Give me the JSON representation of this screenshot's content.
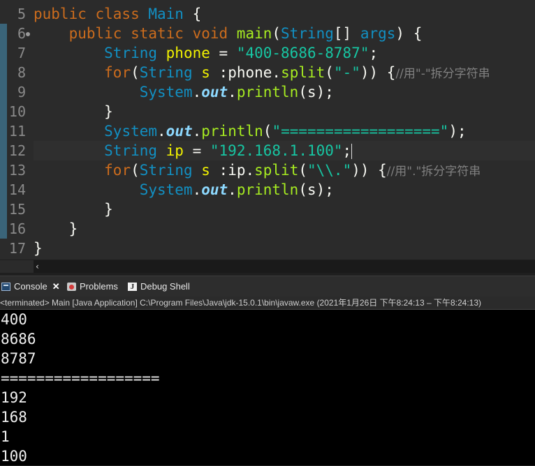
{
  "editor": {
    "line_numbers": [
      "5",
      "6",
      "7",
      "8",
      "9",
      "10",
      "11",
      "12",
      "13",
      "14",
      "15",
      "16",
      "17"
    ],
    "lines": [
      [
        {
          "t": "public class ",
          "c": "kw"
        },
        {
          "t": "Main",
          "c": "ty"
        },
        {
          "t": " {",
          "c": "pl"
        }
      ],
      [
        {
          "t": "    public static void ",
          "c": "kw"
        },
        {
          "t": "main",
          "c": "mt"
        },
        {
          "t": "(",
          "c": "pl"
        },
        {
          "t": "String",
          "c": "ty"
        },
        {
          "t": "[] ",
          "c": "pl"
        },
        {
          "t": "args",
          "c": "ty"
        },
        {
          "t": ") {",
          "c": "pl"
        }
      ],
      [
        {
          "t": "        ",
          "c": "pl"
        },
        {
          "t": "String",
          "c": "ty"
        },
        {
          "t": " phone",
          "c": "var"
        },
        {
          "t": " = ",
          "c": "pl"
        },
        {
          "t": "\"400-8686-8787\"",
          "c": "str"
        },
        {
          "t": ";",
          "c": "pl"
        }
      ],
      [
        {
          "t": "        ",
          "c": "pl"
        },
        {
          "t": "for",
          "c": "kw"
        },
        {
          "t": "(",
          "c": "pl"
        },
        {
          "t": "String",
          "c": "ty"
        },
        {
          "t": " s ",
          "c": "var"
        },
        {
          "t": ":phone.",
          "c": "pl"
        },
        {
          "t": "split",
          "c": "mt"
        },
        {
          "t": "(",
          "c": "pl"
        },
        {
          "t": "\"-\"",
          "c": "str"
        },
        {
          "t": ")) {",
          "c": "pl"
        },
        {
          "t": "//用\"-\"拆分字符串",
          "c": "cm"
        }
      ],
      [
        {
          "t": "            ",
          "c": "pl"
        },
        {
          "t": "System",
          "c": "ty"
        },
        {
          "t": ".",
          "c": "pl"
        },
        {
          "t": "out",
          "c": "fld"
        },
        {
          "t": ".",
          "c": "pl"
        },
        {
          "t": "println",
          "c": "mt"
        },
        {
          "t": "(s);",
          "c": "pl"
        }
      ],
      [
        {
          "t": "        }",
          "c": "pl"
        }
      ],
      [
        {
          "t": "        ",
          "c": "pl"
        },
        {
          "t": "System",
          "c": "ty"
        },
        {
          "t": ".",
          "c": "pl"
        },
        {
          "t": "out",
          "c": "fld"
        },
        {
          "t": ".",
          "c": "pl"
        },
        {
          "t": "println",
          "c": "mt"
        },
        {
          "t": "(",
          "c": "pl"
        },
        {
          "t": "\"==================\"",
          "c": "str"
        },
        {
          "t": ");",
          "c": "pl"
        }
      ],
      [
        {
          "t": "        ",
          "c": "pl"
        },
        {
          "t": "String",
          "c": "ty"
        },
        {
          "t": " ip",
          "c": "var"
        },
        {
          "t": " = ",
          "c": "pl"
        },
        {
          "t": "\"192.168.1.100\"",
          "c": "str"
        },
        {
          "t": ";",
          "c": "pl"
        }
      ],
      [
        {
          "t": "        ",
          "c": "pl"
        },
        {
          "t": "for",
          "c": "kw"
        },
        {
          "t": "(",
          "c": "pl"
        },
        {
          "t": "String",
          "c": "ty"
        },
        {
          "t": " s ",
          "c": "var"
        },
        {
          "t": ":ip.",
          "c": "pl"
        },
        {
          "t": "split",
          "c": "mt"
        },
        {
          "t": "(",
          "c": "pl"
        },
        {
          "t": "\"\\\\.\"",
          "c": "str"
        },
        {
          "t": ")) {",
          "c": "pl"
        },
        {
          "t": "//用\".\"拆分字符串",
          "c": "cm"
        }
      ],
      [
        {
          "t": "            ",
          "c": "pl"
        },
        {
          "t": "System",
          "c": "ty"
        },
        {
          "t": ".",
          "c": "pl"
        },
        {
          "t": "out",
          "c": "fld"
        },
        {
          "t": ".",
          "c": "pl"
        },
        {
          "t": "println",
          "c": "mt"
        },
        {
          "t": "(s);",
          "c": "pl"
        }
      ],
      [
        {
          "t": "        }",
          "c": "pl"
        }
      ],
      [
        {
          "t": "    }",
          "c": "pl"
        }
      ],
      [
        {
          "t": "}",
          "c": "pl"
        }
      ]
    ],
    "scroll_arrow": "‹"
  },
  "tabs": {
    "console": "Console",
    "close": "✕",
    "problems": "Problems",
    "debug_shell": "Debug Shell",
    "debug_glyph": "J"
  },
  "status": "<terminated> Main [Java Application] C:\\Program Files\\Java\\jdk-15.0.1\\bin\\javaw.exe  (2021年1月26日 下午8:24:13 – 下午8:24:13)",
  "output": [
    "400",
    "8686",
    "8787",
    "==================",
    "192",
    "168",
    "1",
    "100"
  ],
  "colors": {
    "editor_bg": "#2b2b2b",
    "keyword": "#cc6c1d",
    "type": "#1290c3",
    "string": "#17c6a3",
    "method": "#a7ec21",
    "variable": "#f2f200",
    "console_bg": "#000000"
  }
}
